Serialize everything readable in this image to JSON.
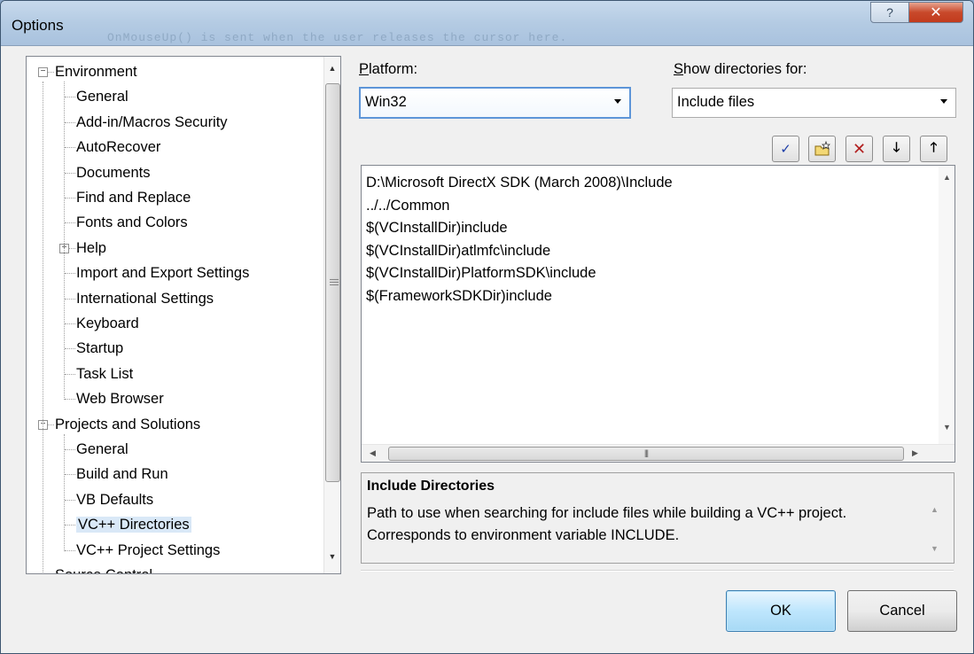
{
  "window": {
    "title": "Options",
    "ghost_text": "OnMouseUp() is sent when the user releases the cursor here."
  },
  "titlebar": {
    "help_icon": "question-icon",
    "close_icon": "close-icon"
  },
  "tree": {
    "items": [
      {
        "label": "Environment",
        "level": 0,
        "expander": "minus"
      },
      {
        "label": "General",
        "level": 1
      },
      {
        "label": "Add-in/Macros Security",
        "level": 1
      },
      {
        "label": "AutoRecover",
        "level": 1
      },
      {
        "label": "Documents",
        "level": 1
      },
      {
        "label": "Find and Replace",
        "level": 1
      },
      {
        "label": "Fonts and Colors",
        "level": 1
      },
      {
        "label": "Help",
        "level": 1,
        "expander": "plus"
      },
      {
        "label": "Import and Export Settings",
        "level": 1
      },
      {
        "label": "International Settings",
        "level": 1
      },
      {
        "label": "Keyboard",
        "level": 1
      },
      {
        "label": "Startup",
        "level": 1
      },
      {
        "label": "Task List",
        "level": 1
      },
      {
        "label": "Web Browser",
        "level": 1
      },
      {
        "label": "Projects and Solutions",
        "level": 0,
        "expander": "minus"
      },
      {
        "label": "General",
        "level": 1
      },
      {
        "label": "Build and Run",
        "level": 1
      },
      {
        "label": "VB Defaults",
        "level": 1
      },
      {
        "label": "VC++ Directories",
        "level": 1,
        "selected": true
      },
      {
        "label": "VC++ Project Settings",
        "level": 1
      },
      {
        "label": "Source Control",
        "level": 0
      }
    ]
  },
  "platform": {
    "label": "Platform:",
    "value": "Win32"
  },
  "show_dirs": {
    "label": "Show directories for:",
    "value": "Include files"
  },
  "toolbar": {
    "check_icon": "checkmark-icon",
    "new_folder_icon": "new-folder-icon",
    "delete_icon": "delete-x-icon",
    "move_down_icon": "arrow-down-icon",
    "move_up_icon": "arrow-up-icon"
  },
  "directories": [
    "D:\\Microsoft DirectX SDK (March 2008)\\Include",
    "../../Common",
    "$(VCInstallDir)include",
    "$(VCInstallDir)atlmfc\\include",
    "$(VCInstallDir)PlatformSDK\\include",
    "$(FrameworkSDKDir)include"
  ],
  "description": {
    "title": "Include Directories",
    "body": "Path to use when searching for include files while building a VC++ project.  Corresponds to environment variable INCLUDE."
  },
  "buttons": {
    "ok": "OK",
    "cancel": "Cancel"
  },
  "colors": {
    "selection": "#d9e8f7",
    "ok_border": "#3c7fb1",
    "close_red": "#c8492b"
  }
}
